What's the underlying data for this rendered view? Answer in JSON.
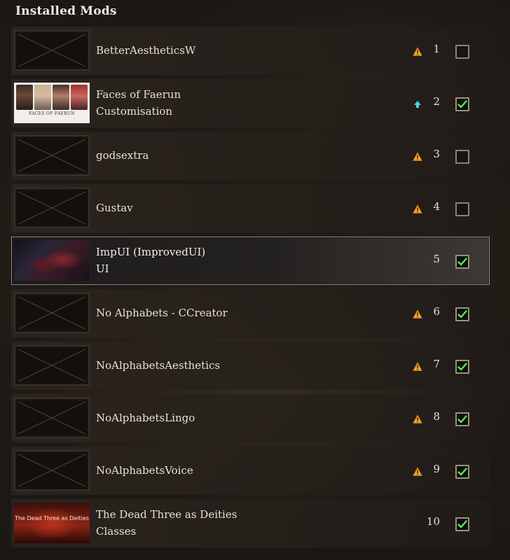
{
  "header": {
    "title": "Installed Mods"
  },
  "colors": {
    "warning": "#f5a623",
    "update": "#3fd6e6",
    "check": "#5ee84a"
  },
  "mods": [
    {
      "name_line1": "BetterAestheticsW",
      "name_line2": "",
      "index": "1",
      "status": "warning-icon",
      "enabled": false,
      "thumbnail": "placeholder"
    },
    {
      "name_line1": "Faces of Faerun",
      "name_line2": "Customisation",
      "index": "2",
      "status": "update-icon",
      "enabled": true,
      "thumbnail": "faces",
      "thumbnail_caption": "FACES OF FAERUN"
    },
    {
      "name_line1": "godsextra",
      "name_line2": "",
      "index": "3",
      "status": "warning-icon",
      "enabled": false,
      "thumbnail": "placeholder"
    },
    {
      "name_line1": "Gustav",
      "name_line2": "",
      "index": "4",
      "status": "warning-icon",
      "enabled": false,
      "thumbnail": "placeholder"
    },
    {
      "name_line1": "ImpUI (ImprovedUI)",
      "name_line2": "UI",
      "index": "5",
      "status": "",
      "enabled": true,
      "thumbnail": "impui"
    },
    {
      "name_line1": "No Alphabets - CCreator",
      "name_line2": "",
      "index": "6",
      "status": "warning-icon",
      "enabled": true,
      "thumbnail": "placeholder"
    },
    {
      "name_line1": "NoAlphabetsAesthetics",
      "name_line2": "",
      "index": "7",
      "status": "warning-icon",
      "enabled": true,
      "thumbnail": "placeholder"
    },
    {
      "name_line1": "NoAlphabetsLingo",
      "name_line2": "",
      "index": "8",
      "status": "warning-icon",
      "enabled": true,
      "thumbnail": "placeholder"
    },
    {
      "name_line1": "NoAlphabetsVoice",
      "name_line2": "",
      "index": "9",
      "status": "warning-icon",
      "enabled": true,
      "thumbnail": "placeholder"
    },
    {
      "name_line1": "The Dead Three as Deities",
      "name_line2": "Classes",
      "index": "10",
      "status": "",
      "enabled": true,
      "thumbnail": "deadthree",
      "thumbnail_caption": "The Dead Three as Deities"
    }
  ]
}
